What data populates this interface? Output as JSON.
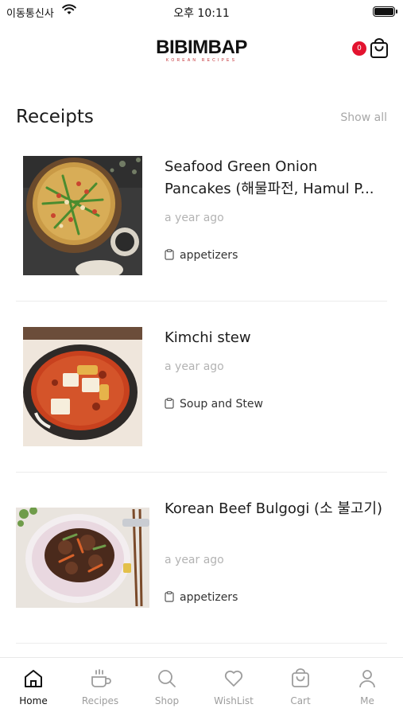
{
  "status_bar": {
    "carrier": "이동통신사",
    "time": "오후 10:11"
  },
  "header": {
    "brand": "BIBIMBAP",
    "tagline": "KOREAN RECIPES",
    "cart_count": "0"
  },
  "section": {
    "title": "Receipts",
    "show_all": "Show all"
  },
  "recipes": [
    {
      "title": "Seafood Green Onion Pancakes (해물파전, Hamul P...",
      "time": "a year ago",
      "category": "appetizers"
    },
    {
      "title": "Kimchi stew",
      "time": "a year ago",
      "category": "Soup and Stew"
    },
    {
      "title": "Korean Beef Bulgogi (소 불고기)",
      "time": "a year ago",
      "category": "appetizers"
    }
  ],
  "tabs": [
    {
      "label": "Home",
      "icon": "home-icon",
      "active": true
    },
    {
      "label": "Recipes",
      "icon": "coffee-cup-icon",
      "active": false
    },
    {
      "label": "Shop",
      "icon": "search-icon",
      "active": false
    },
    {
      "label": "WishList",
      "icon": "heart-icon",
      "active": false
    },
    {
      "label": "Cart",
      "icon": "shopping-bag-icon",
      "active": false
    },
    {
      "label": "Me",
      "icon": "user-icon",
      "active": false
    }
  ],
  "colors": {
    "accent_red": "#e3132f",
    "muted_text": "#b3b3b3"
  }
}
